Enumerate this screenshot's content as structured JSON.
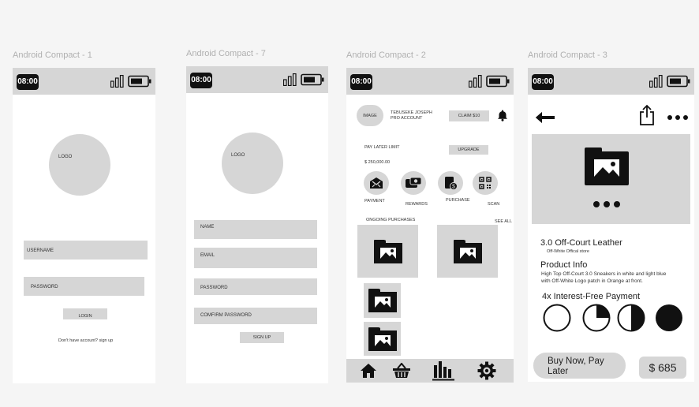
{
  "frames": [
    {
      "label": "Android Compact - 1",
      "time": "08:00"
    },
    {
      "label": "Android Compact - 7",
      "time": "08:00"
    },
    {
      "label": "Android Compact - 2",
      "time": "08:00"
    },
    {
      "label": "Android Compact - 3",
      "time": "08:00"
    }
  ],
  "login": {
    "logo": "LOGO",
    "username_label": "USERNAME",
    "password_label": "PASSWORD",
    "login_button": "LOGIN",
    "signup_prompt": "Don't have account?  sign up"
  },
  "signup": {
    "logo": "LOGO",
    "name_label": "NAME",
    "email_label": "EMAIL",
    "password_label": "PASSWORD",
    "confirm_password_label": "COMFIRM PASSWORD",
    "signup_button": "SIGN UP"
  },
  "home": {
    "avatar": "IMAGE",
    "user_name": "TEBUSEKE  JOSEPH",
    "account_type": "PRO ACCOUNT",
    "claim_button": "CLAIM  $10",
    "pay_later_label": "PAY LATER LIMIT",
    "pay_later_amount": "$ 250,000.00",
    "upgrade_button": "UPGRADE",
    "actions": [
      {
        "label": "PAYMENT",
        "icon": "payment-icon"
      },
      {
        "label": "REWARDS",
        "icon": "rewards-icon"
      },
      {
        "label": "PURCHASE",
        "icon": "purchase-icon"
      },
      {
        "label": "SCAN",
        "icon": "qr-scan-icon"
      }
    ],
    "ongoing_label": "ONGOING  PURCHASES",
    "see_all": "SEE ALL",
    "nav": [
      "home-icon",
      "basket-icon",
      "stats-icon",
      "settings-icon"
    ]
  },
  "product": {
    "title": "3.0 Off-Court Leather",
    "store": "Off-White Offical store",
    "info_heading": "Product Info",
    "info_text_1": "High Top Off-Court 3.0 Sneakers in white and light blue",
    "info_text_2": "with Off-White Logo patch in Orange at front.",
    "installments_heading": "4x Interest-Free Payment",
    "installment_progress": [
      0,
      0.25,
      0.5,
      1
    ],
    "buy_button": "Buy Now, Pay Later",
    "price": "$ 685"
  },
  "colors": {
    "placeholder": "#d6d6d6",
    "dark": "#111111"
  }
}
